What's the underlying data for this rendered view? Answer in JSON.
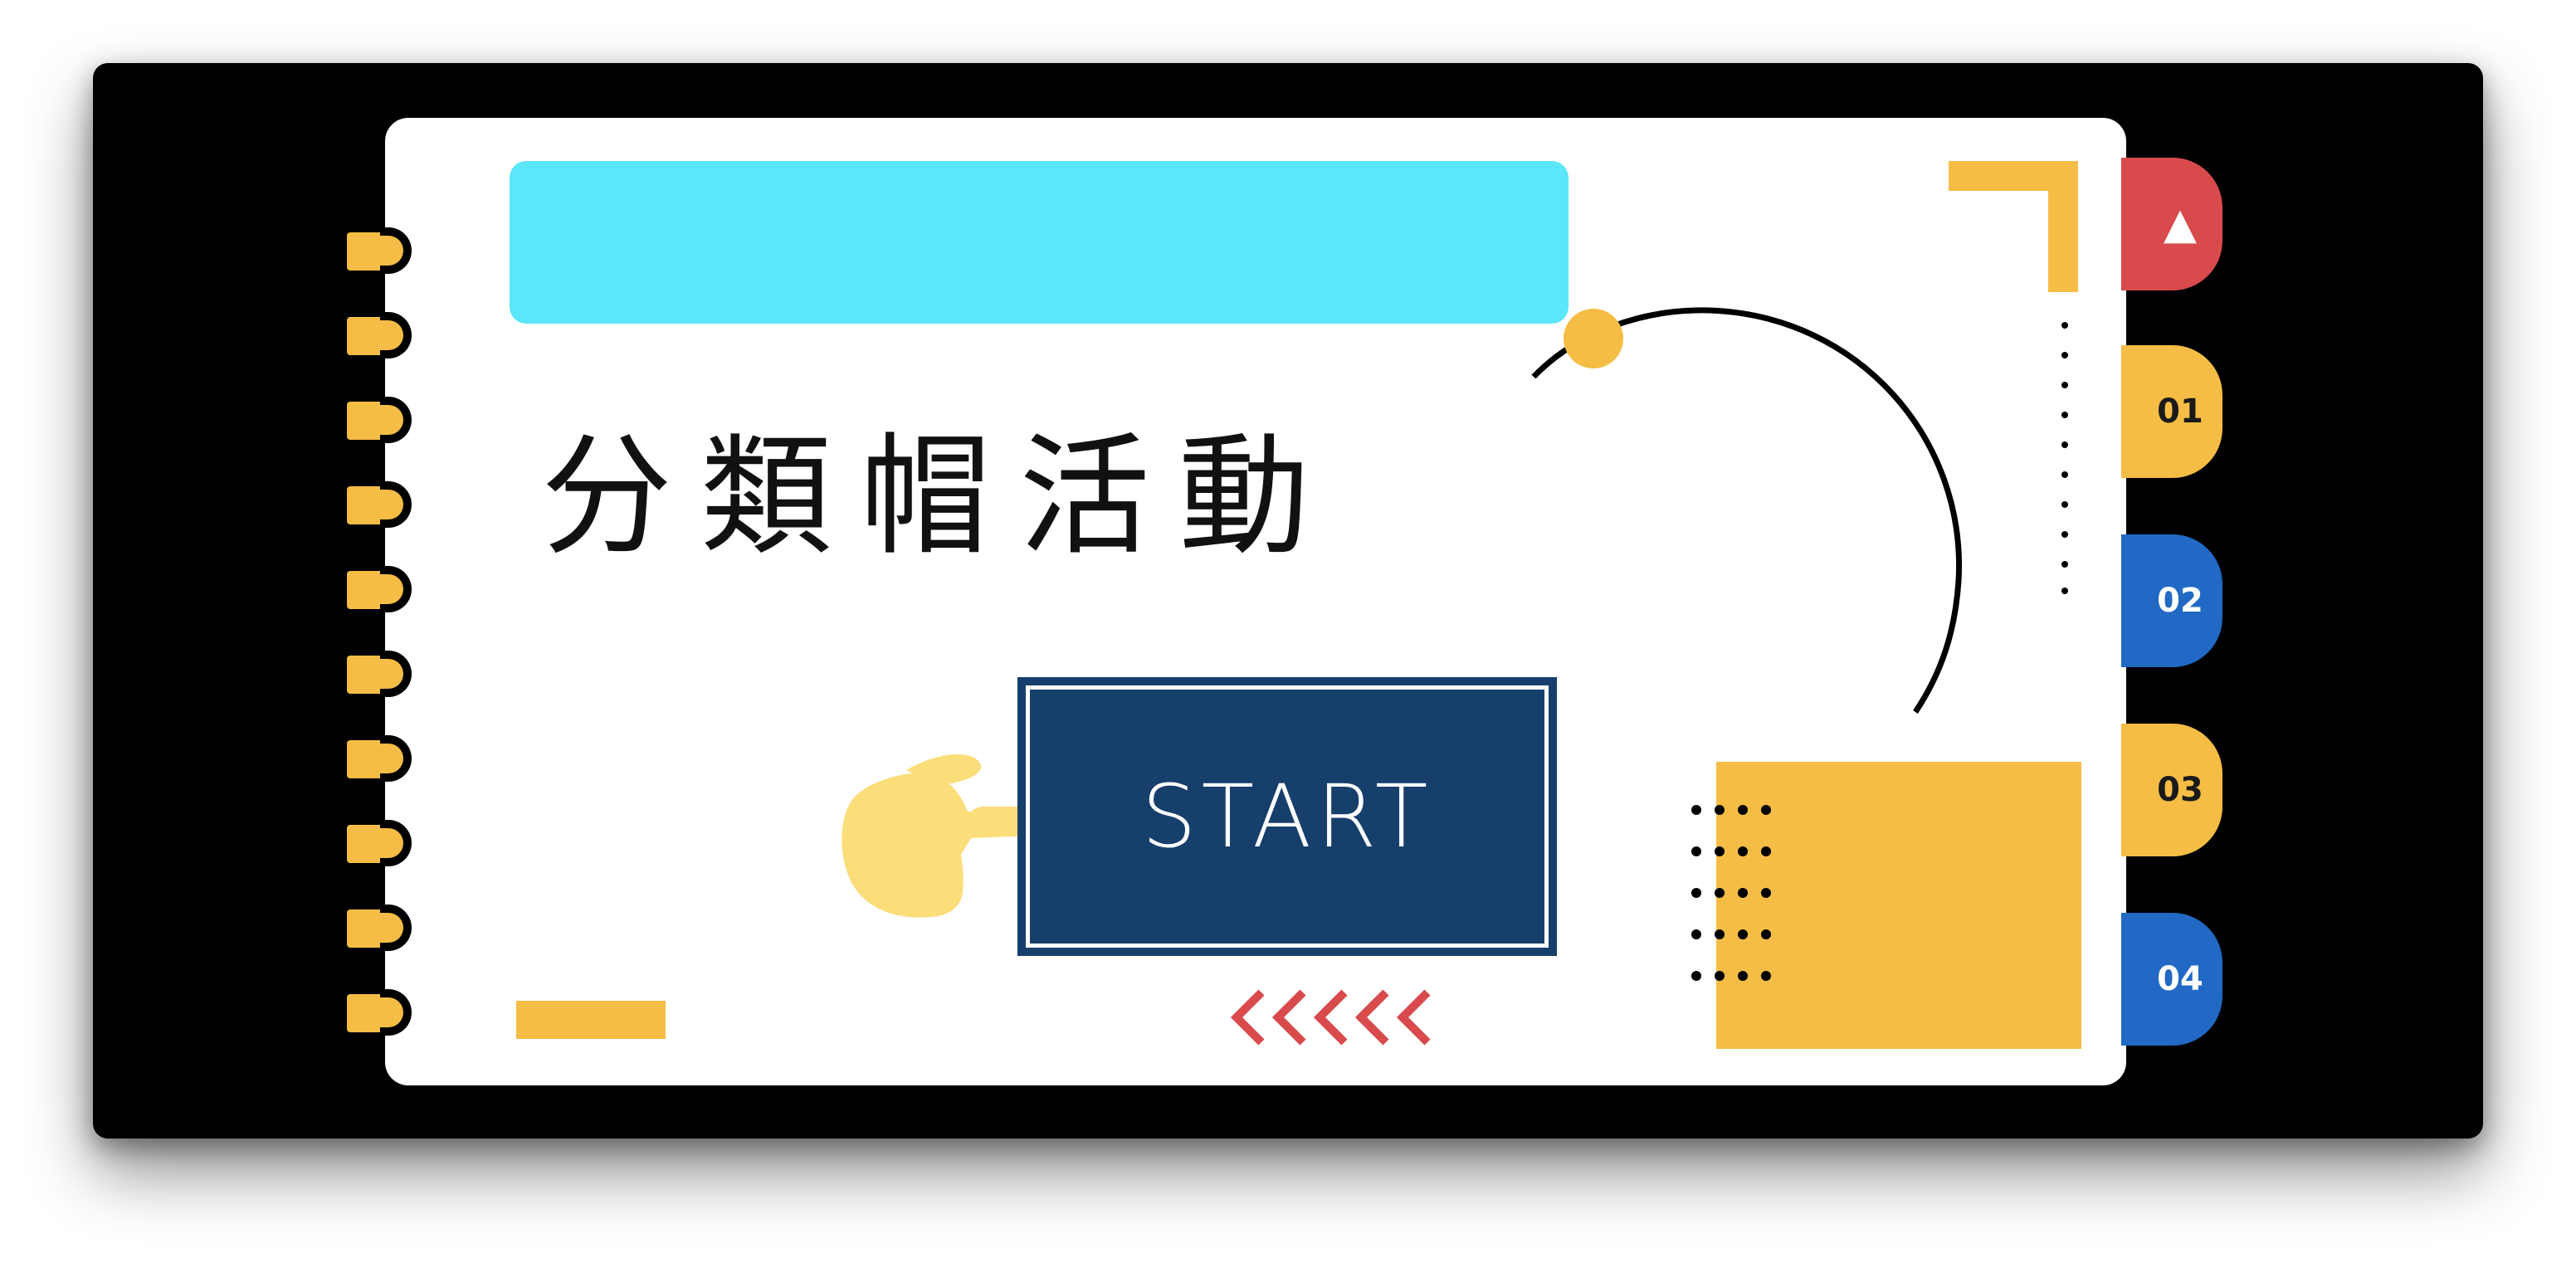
{
  "slide": {
    "title": "分類帽活動",
    "start_label": "START"
  },
  "nav_tabs": [
    {
      "label": "▲",
      "icon": "triangle-up-icon",
      "color": "#d84a4c"
    },
    {
      "label": "01",
      "color": "#f5bd45"
    },
    {
      "label": "02",
      "color": "#2169c4"
    },
    {
      "label": "03",
      "color": "#f5bd45"
    },
    {
      "label": "04",
      "color": "#2169c4"
    }
  ],
  "colors": {
    "background": "#000000",
    "card": "#ffffff",
    "accent_cyan": "#5ce6f9",
    "accent_yellow": "#f5bd45",
    "button_navy": "#173f6c",
    "accent_red": "#d84a4c",
    "accent_blue": "#2169c4"
  }
}
